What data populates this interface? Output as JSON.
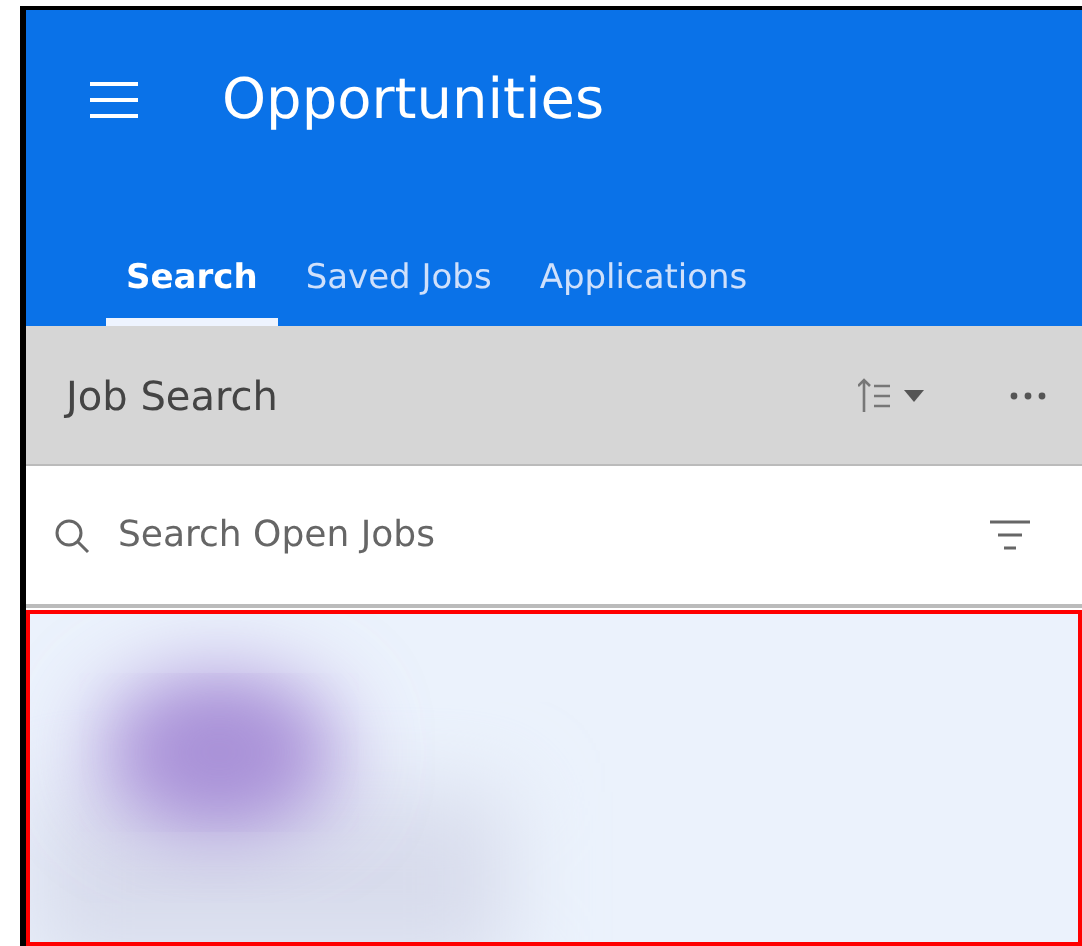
{
  "header": {
    "title": "Opportunities"
  },
  "tabs": [
    {
      "label": "Search",
      "selected": true
    },
    {
      "label": "Saved Jobs",
      "selected": false
    },
    {
      "label": "Applications",
      "selected": false
    }
  ],
  "toolbar": {
    "title": "Job Search"
  },
  "search": {
    "placeholder": "Search Open Jobs"
  }
}
